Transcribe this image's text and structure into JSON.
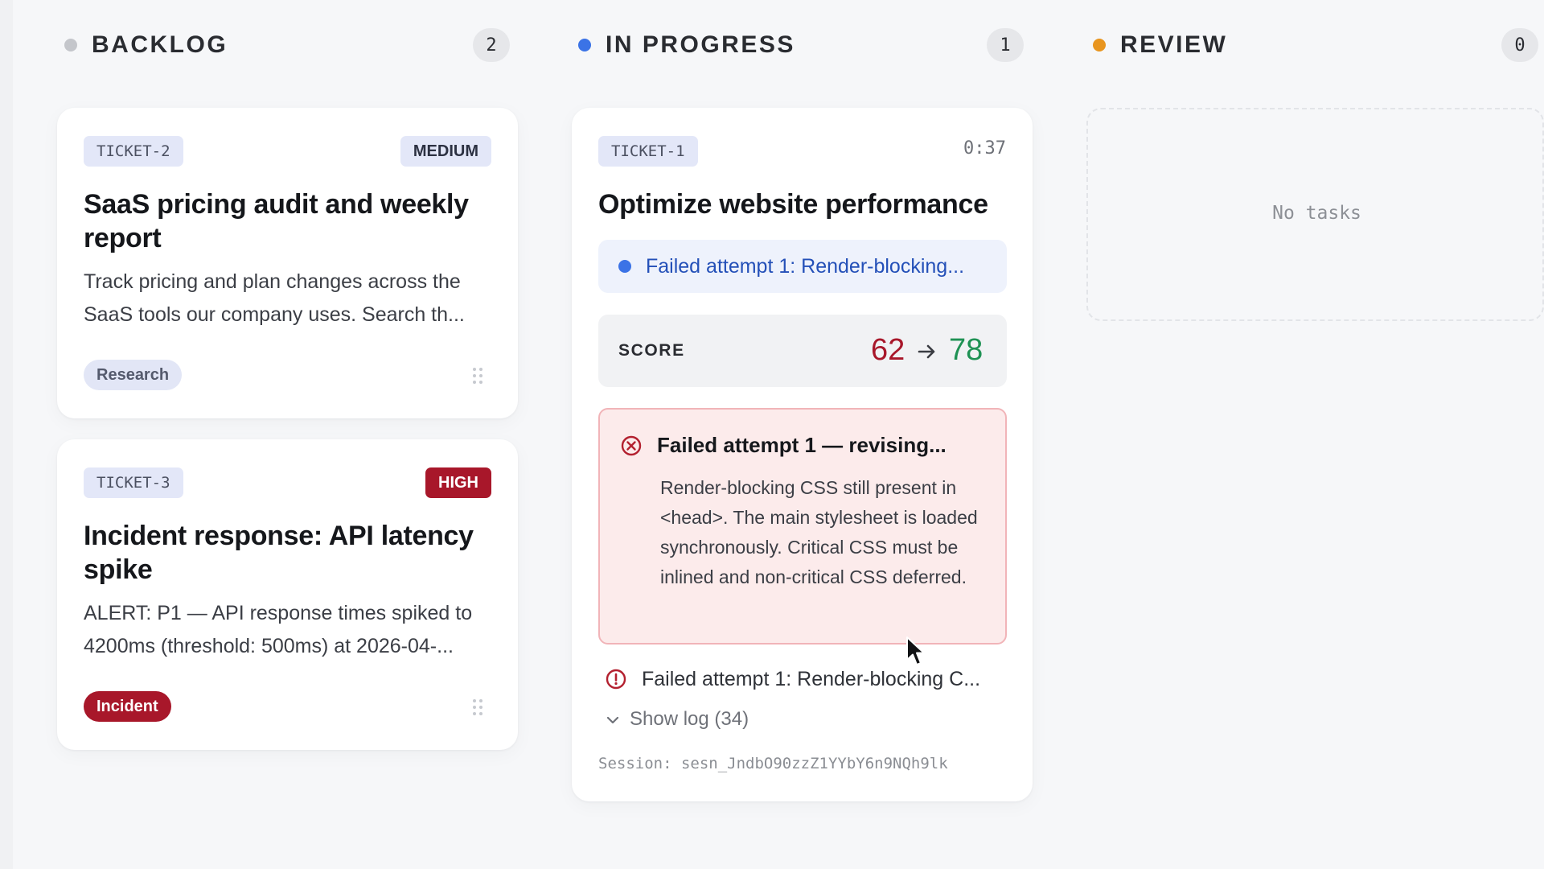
{
  "columns": [
    {
      "name": "BACKLOG",
      "count": "2",
      "dot_color": "#c4c6cb"
    },
    {
      "name": "IN PROGRESS",
      "count": "1",
      "dot_color": "#3b73e6"
    },
    {
      "name": "REVIEW",
      "count": "0",
      "dot_color": "#e8951f",
      "empty_text": "No tasks"
    }
  ],
  "backlog": [
    {
      "ticket": "TICKET-2",
      "priority": "MEDIUM",
      "title": "SaaS pricing audit and weekly report",
      "description": "Track pricing and plan changes across the SaaS tools our company uses. Search th...",
      "tag": "Research"
    },
    {
      "ticket": "TICKET-3",
      "priority": "HIGH",
      "title": "Incident response: API latency spike",
      "description": "ALERT: P1 — API response times spiked to 4200ms (threshold: 500ms) at 2026-04-...",
      "tag": "Incident"
    }
  ],
  "in_progress": {
    "ticket": "TICKET-1",
    "timer": "0:37",
    "title": "Optimize website performance",
    "status": "Failed attempt 1: Render-blocking...",
    "score": {
      "label": "SCORE",
      "from": "62",
      "to": "78",
      "from_color": "#a8172a",
      "to_color": "#1f9254"
    },
    "error": {
      "title": "Failed attempt 1 — revising...",
      "body": "Render-blocking CSS still present in <head>. The main stylesheet is loaded synchronously. Critical CSS must be inlined and non-critical CSS deferred."
    },
    "warning": "Failed attempt 1: Render-blocking C...",
    "show_log": "Show log (34)",
    "session": "Session: sesn_JndbO90zzZ1YYbY6n9NQh9lk"
  },
  "icons": {
    "column_dot": "status-dot",
    "drag": "drag-handle-icon",
    "error": "x-circle-icon",
    "warning": "alert-circle-icon",
    "chevron": "chevron-down-icon",
    "arrow": "arrow-right-icon",
    "cursor": "mouse-pointer"
  }
}
